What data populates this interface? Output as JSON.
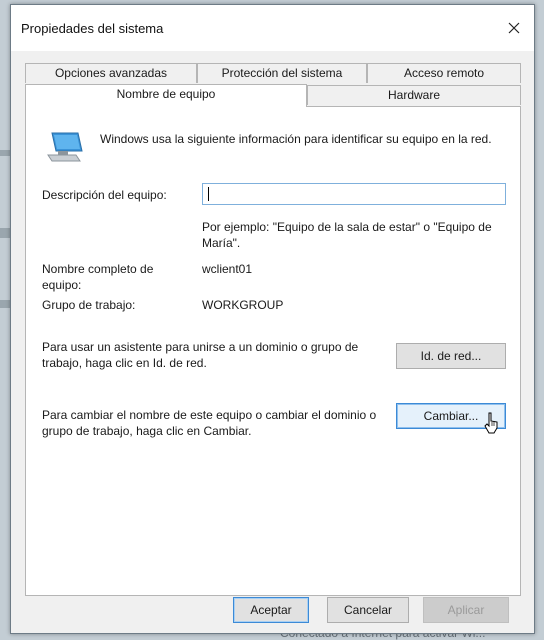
{
  "window": {
    "title": "Propiedades del sistema"
  },
  "tabs": [
    {
      "label": "Opciones avanzadas",
      "active": false
    },
    {
      "label": "Protección del sistema",
      "active": false
    },
    {
      "label": "Acceso remoto",
      "active": false
    },
    {
      "label": "Nombre de equipo",
      "active": true
    },
    {
      "label": "Hardware",
      "active": false
    }
  ],
  "computer_name_tab": {
    "intro": "Windows usa la siguiente información para identificar su equipo en la red.",
    "description_label": "Descripción del equipo:",
    "description_value": "",
    "description_hint": "Por ejemplo: \"Equipo de la sala de estar\" o \"Equipo de María\".",
    "full_name_label": "Nombre completo de equipo:",
    "full_name_value": "wclient01",
    "workgroup_label": "Grupo de trabajo:",
    "workgroup_value": "WORKGROUP",
    "network_id_text": "Para usar un asistente para unirse a un dominio o grupo de trabajo, haga clic en Id. de red.",
    "network_id_button": "Id. de red...",
    "change_text": "Para cambiar el nombre de este equipo o cambiar el dominio o grupo de trabajo, haga clic en Cambiar.",
    "change_button": "Cambiar..."
  },
  "footer": {
    "ok_button": "Aceptar",
    "cancel_button": "Cancelar",
    "apply_button": "Aplicar"
  },
  "backdrop_caption": "Conectado a Internet para activar Wi...",
  "colors": {
    "accent": "#3c8ad6",
    "input_border": "#7fb0dc",
    "dialog_bg": "#f0f0f0",
    "panel_bg": "#ffffff"
  },
  "icons": {
    "computer": "computer-icon",
    "close": "close-icon",
    "cursor": "mouse-pointer-icon"
  }
}
